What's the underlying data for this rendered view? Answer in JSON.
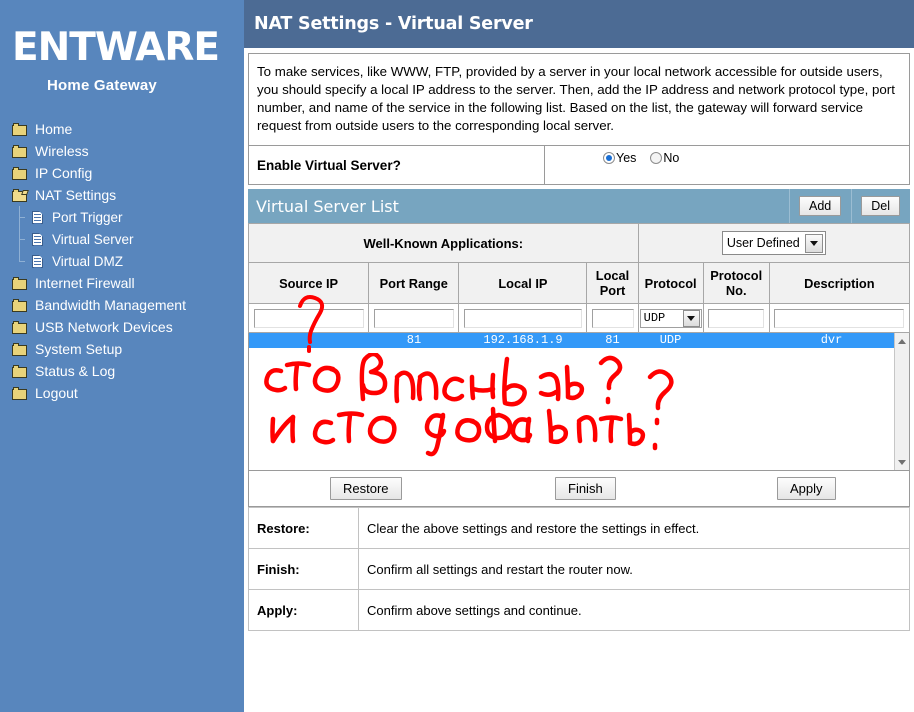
{
  "sidebar": {
    "brand": "ENTWARE",
    "brand_sub": "Home Gateway",
    "items": [
      {
        "label": "Home",
        "icon": "folder-icon",
        "type": "folder"
      },
      {
        "label": "Wireless",
        "icon": "folder-icon",
        "type": "folder"
      },
      {
        "label": "IP Config",
        "icon": "folder-icon",
        "type": "folder"
      },
      {
        "label": "NAT Settings",
        "icon": "folder-open-icon",
        "type": "folder-open"
      },
      {
        "label": "Port Trigger",
        "icon": "document-icon",
        "type": "doc"
      },
      {
        "label": "Virtual Server",
        "icon": "document-icon",
        "type": "doc"
      },
      {
        "label": "Virtual DMZ",
        "icon": "document-icon",
        "type": "doc"
      },
      {
        "label": "Internet Firewall",
        "icon": "folder-icon",
        "type": "folder"
      },
      {
        "label": "Bandwidth Management",
        "icon": "folder-icon",
        "type": "folder"
      },
      {
        "label": "USB Network Devices",
        "icon": "folder-icon",
        "type": "folder"
      },
      {
        "label": "System Setup",
        "icon": "folder-icon",
        "type": "folder"
      },
      {
        "label": "Status & Log",
        "icon": "folder-icon",
        "type": "folder"
      },
      {
        "label": "Logout",
        "icon": "folder-icon",
        "type": "folder"
      }
    ]
  },
  "header": {
    "title": "NAT Settings - Virtual Server"
  },
  "intro": {
    "text": "To make services, like WWW, FTP, provided by a server in your local network accessible for outside users, you should specify a local IP address to the server. Then, add the IP address and network protocol type, port number, and name of the service in the following list. Based on the list, the gateway will forward service request from outside users to the corresponding local server."
  },
  "enable": {
    "label": "Enable Virtual Server?",
    "yes_label": "Yes",
    "no_label": "No",
    "selected": "Yes"
  },
  "list_bar": {
    "title": "Virtual Server List",
    "add_label": "Add",
    "del_label": "Del"
  },
  "well_known": {
    "label": "Well-Known Applications:",
    "selected": "User Defined"
  },
  "table": {
    "columns": [
      "Source IP",
      "Port Range",
      "Local IP",
      "Local Port",
      "Protocol",
      "Protocol No.",
      "Description"
    ],
    "input_row": {
      "source_ip": "",
      "port_range": "",
      "local_ip": "",
      "local_port": "",
      "protocol": "UDP",
      "protocol_no": "",
      "description": ""
    },
    "rows": [
      {
        "source_ip": "",
        "port_range": "81",
        "local_ip": "192.168.1.9",
        "local_port": "81",
        "protocol": "UDP",
        "protocol_no": "",
        "description": "dvr",
        "selected": true
      }
    ]
  },
  "annotation": {
    "line1": "что вписывать?",
    "line2": "и что добавить.",
    "extra_mark": "?",
    "color": "#ff0000"
  },
  "actions": {
    "restore_label": "Restore",
    "finish_label": "Finish",
    "apply_label": "Apply"
  },
  "legend": [
    {
      "key": "Restore:",
      "value": "Clear the above settings and restore the settings in effect."
    },
    {
      "key": "Finish:",
      "value": "Confirm all settings and restart the router now."
    },
    {
      "key": "Apply:",
      "value": "Confirm above settings and continue."
    }
  ],
  "colors": {
    "header_bar": "#4c6b94",
    "sidebar": "#5886bd",
    "list_bar": "#77a5c0",
    "row_selected": "#3399f8",
    "annotation": "#ff0000"
  }
}
